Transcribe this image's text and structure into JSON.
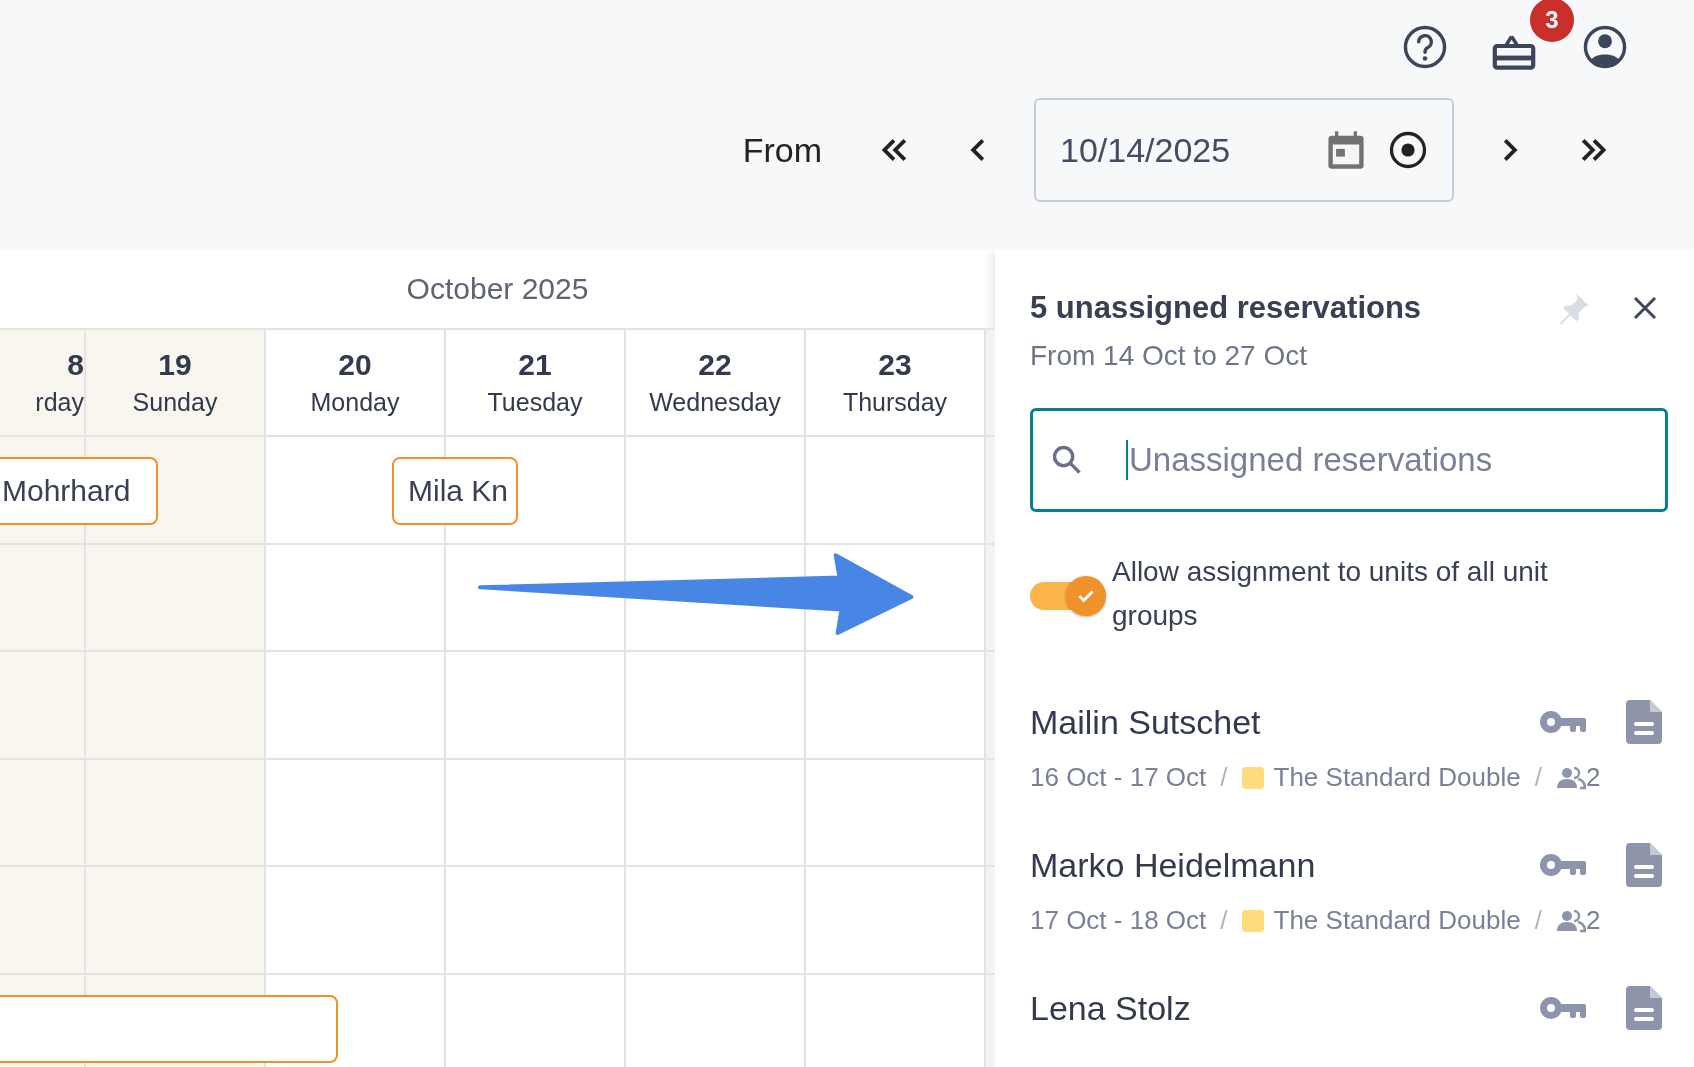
{
  "header": {
    "notification_badge": "3"
  },
  "date_nav": {
    "label": "From",
    "date": "10/14/2025"
  },
  "calendar": {
    "month": "October 2025",
    "days": [
      {
        "number": "8",
        "name": "rday",
        "weekend": true
      },
      {
        "number": "19",
        "name": "Sunday",
        "weekend": true
      },
      {
        "number": "20",
        "name": "Monday",
        "weekend": false
      },
      {
        "number": "21",
        "name": "Tuesday",
        "weekend": false
      },
      {
        "number": "22",
        "name": "Wednesday",
        "weekend": false
      },
      {
        "number": "23",
        "name": "Thursday",
        "weekend": false
      }
    ],
    "bookings": [
      {
        "kind": "reservation",
        "name": "Mohrhard"
      },
      {
        "kind": "reservation",
        "name": "Mila Kn"
      },
      {
        "kind": "reservation"
      }
    ]
  },
  "panel": {
    "title": "5 unassigned reservations",
    "subtitle": "From 14 Oct to 27 Oct",
    "pinned": false,
    "search": {
      "placeholder": "Unassigned reservations",
      "focused": true
    },
    "toggle": {
      "label": "Allow assignment to units of all unit groups",
      "on": true
    },
    "reservations": [
      {
        "name": "Mailin Sutschet",
        "dates": "16 Oct - 17 Oct",
        "separator": "/",
        "unit": "The Standard Double",
        "color": "#fddc7b",
        "guests": "2"
      },
      {
        "name": "Marko Heidelmann",
        "dates": "17 Oct - 18 Oct",
        "separator": "/",
        "unit": "The Standard Double",
        "color": "#fddc7b",
        "guests": "2"
      },
      {
        "name": "Lena Stolz"
      }
    ]
  }
}
